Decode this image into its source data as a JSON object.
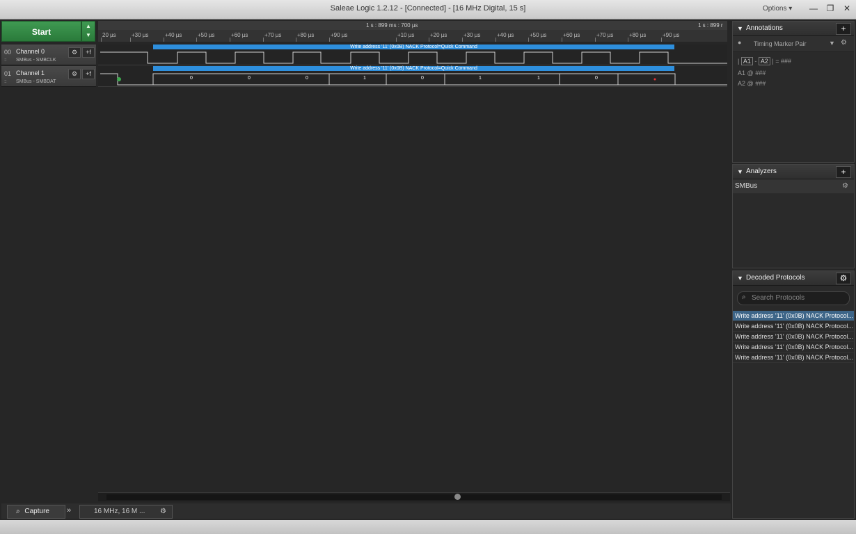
{
  "window": {
    "title": "Saleae Logic 1.2.12 - [Connected] - [16 MHz Digital, 15 s]",
    "options_label": "Options",
    "options_arrow": "▾",
    "minimize": "—",
    "restore": "❐",
    "close": "✕"
  },
  "start_button": {
    "label": "Start",
    "up": "▲",
    "down": "▼"
  },
  "channels": [
    {
      "num": "00",
      "name": "Channel 0",
      "sub": "SMBus - SMBCLK"
    },
    {
      "num": "01",
      "name": "Channel 1",
      "sub": "SMBus - SMBDAT"
    }
  ],
  "ruler": {
    "center": "1 s : 899 ms : 700 µs",
    "right": "1 s : 899 r",
    "ticks": [
      "20 µs",
      "+30 µs",
      "+40 µs",
      "+50 µs",
      "+60 µs",
      "+70 µs",
      "+80 µs",
      "+90 µs",
      "+10 µs",
      "+20 µs",
      "+30 µs",
      "+40 µs",
      "+50 µs",
      "+60 µs",
      "+70 µs",
      "+80 µs",
      "+90 µs"
    ]
  },
  "decode_bubble": "Write address '11' (0x0B) NACK Protocol=Quick Command",
  "bits": [
    "0",
    "0",
    "0",
    "1",
    "0",
    "1",
    "1",
    "0"
  ],
  "bottom": {
    "capture_tab": "Capture",
    "session_tab": "16 MHz, 16 M ..."
  },
  "annotations": {
    "header": "Annotations",
    "marker": "Timing Marker Pair",
    "formula": {
      "a1": "A1",
      "a2": "A2",
      "result": "###"
    },
    "a1_row": {
      "label": "A1",
      "at": "@",
      "value": "###"
    },
    "a2_row": {
      "label": "A2",
      "at": "@",
      "value": "###"
    }
  },
  "analyzers": {
    "header": "Analyzers",
    "items": [
      "SMBus"
    ]
  },
  "decoded": {
    "header": "Decoded Protocols",
    "search_placeholder": "Search Protocols",
    "rows": [
      "Write address '11' (0x0B) NACK Protocol...",
      "Write address '11' (0x0B) NACK Protocol...",
      "Write address '11' (0x0B) NACK Protocol...",
      "Write address '11' (0x0B) NACK Protocol...",
      "Write address '11' (0x0B) NACK Protocol..."
    ]
  },
  "colors": {
    "start_green": "#3f9a52",
    "decode_blue": "#2e8fdd",
    "selected_row": "#3d6588",
    "trace": "#d0d0d0"
  }
}
